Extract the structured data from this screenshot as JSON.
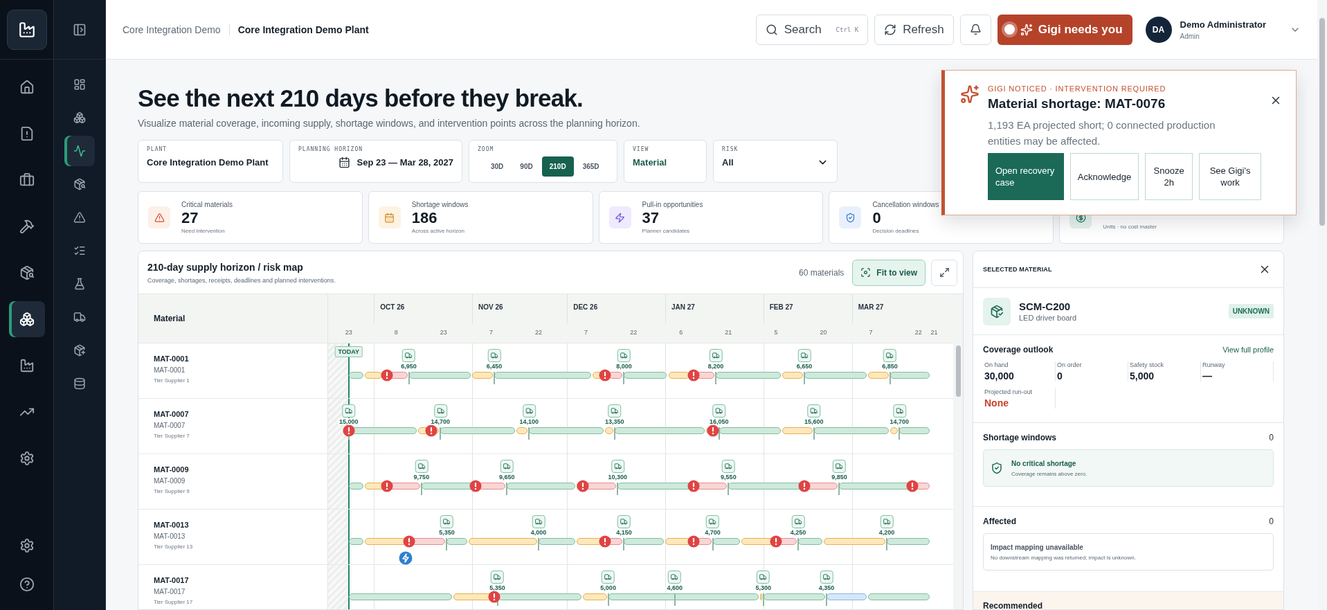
{
  "main_nav": [
    {
      "selected": false
    },
    {
      "selected": false
    },
    {
      "selected": false
    },
    {
      "selected": false
    },
    {
      "selected": false
    },
    {
      "selected": true
    },
    {
      "selected": false
    },
    {
      "selected": false
    },
    {
      "selected": false
    }
  ],
  "sub_nav": [
    {
      "selected": false
    },
    {
      "selected": false
    },
    {
      "selected": true
    },
    {
      "selected": false
    },
    {
      "selected": false
    },
    {
      "selected": false
    },
    {
      "selected": false
    },
    {
      "selected": false
    },
    {
      "selected": false
    },
    {
      "selected": false
    }
  ],
  "header": {
    "breadcrumbs": [
      "Core Integration Demo",
      "Core Integration Demo Plant"
    ],
    "search": {
      "label": "Search",
      "shortcut": "Ctrl K"
    },
    "refresh": "Refresh",
    "assistant": "Gigi needs you",
    "user": {
      "initials": "DA",
      "name": "Demo Administrator",
      "role": "Admin"
    }
  },
  "title": "See the next 210 days before they break.",
  "subtitle": "Visualize material coverage, incoming supply, shortage windows, and intervention points across the planning horizon.",
  "filters": {
    "plant": {
      "label": "PLANT",
      "value": "Core Integration Demo Plant"
    },
    "horizon": {
      "label": "PLANNING HORIZON",
      "value": "Sep 23 — Mar 28, 2027"
    },
    "zoom": {
      "label": "ZOOM",
      "options": [
        {
          "label": "30D",
          "selected": false
        },
        {
          "label": "90D",
          "selected": false
        },
        {
          "label": "210D",
          "selected": true
        },
        {
          "label": "365D",
          "selected": false
        }
      ]
    },
    "view": {
      "label": "VIEW",
      "value": "Material"
    },
    "risk": {
      "label": "RISK",
      "value": "All"
    }
  },
  "kpis": [
    {
      "kind": "critical",
      "label": "Critical materials",
      "value": "27",
      "note": "Need intervention"
    },
    {
      "kind": "shortage",
      "label": "Shortage windows",
      "value": "186",
      "note": "Across active horizon"
    },
    {
      "kind": "pullin",
      "label": "Pull-in opportunities",
      "value": "37",
      "note": "Planner candidates"
    },
    {
      "kind": "cancel",
      "label": "Cancellation windows",
      "value": "0",
      "note": "Decision deadlines"
    },
    {
      "kind": "value",
      "note": "Units · no cost master"
    }
  ],
  "chart": {
    "title": "210-day supply horizon / risk map",
    "subtitle": "Coverage, shortages, receipts, deadlines and planned interventions.",
    "count": "60 materials",
    "fit": "Fit to view",
    "column_header": "Material",
    "today": "TODAY",
    "months": [
      {
        "label": "OCT 26"
      },
      {
        "label": "NOV 26"
      },
      {
        "label": "DEC 26"
      },
      {
        "label": "JAN 27"
      },
      {
        "label": "FEB 27"
      },
      {
        "label": "MAR 27"
      }
    ],
    "ticks": [
      {
        "label": "23"
      },
      {
        "label": "8"
      },
      {
        "label": "23"
      },
      {
        "label": "7"
      },
      {
        "label": "22"
      },
      {
        "label": "7"
      },
      {
        "label": "22"
      },
      {
        "label": "6"
      },
      {
        "label": "21"
      },
      {
        "label": "5"
      },
      {
        "label": "20"
      },
      {
        "label": "7"
      },
      {
        "label": "22"
      },
      {
        "label": "21"
      }
    ],
    "rows": [
      {
        "name": "MAT-0001",
        "code": "MAT-0001",
        "supplier": "Tier Supplier 1",
        "segments": [
          {
            "kind": "ok"
          },
          {
            "kind": "warn"
          },
          {
            "kind": "short"
          },
          {
            "kind": "ok"
          },
          {
            "kind": "warn"
          },
          {
            "kind": "ok"
          },
          {
            "kind": "warn"
          },
          {
            "kind": "short"
          },
          {
            "kind": "ok"
          },
          {
            "kind": "warn"
          },
          {
            "kind": "short"
          },
          {
            "kind": "ok"
          },
          {
            "kind": "warn"
          },
          {
            "kind": "ok"
          },
          {
            "kind": "warn"
          },
          {
            "kind": "ok"
          }
        ],
        "receipts": [
          {
            "qty": "6,950"
          },
          {
            "qty": "6,450"
          },
          {
            "qty": "8,000"
          },
          {
            "qty": "8,200"
          },
          {
            "qty": "6,650"
          },
          {
            "qty": "6,850"
          }
        ],
        "markers": [
          {
            "kind": "alert"
          },
          {
            "kind": "alert"
          },
          {
            "kind": "alert"
          }
        ]
      },
      {
        "name": "MAT-0007",
        "code": "MAT-0007",
        "supplier": "Tier Supplier 7",
        "segments": [
          {
            "kind": "ok"
          },
          {
            "kind": "warn"
          },
          {
            "kind": "ok"
          },
          {
            "kind": "warn"
          },
          {
            "kind": "ok"
          },
          {
            "kind": "warn"
          },
          {
            "kind": "ok"
          },
          {
            "kind": "warn"
          },
          {
            "kind": "ok"
          },
          {
            "kind": "warn"
          },
          {
            "kind": "ok"
          },
          {
            "kind": "warn"
          },
          {
            "kind": "ok"
          }
        ],
        "receipts": [
          {
            "qty": "15,000"
          },
          {
            "qty": "14,700"
          },
          {
            "qty": "14,100"
          },
          {
            "qty": "13,350"
          },
          {
            "qty": "16,050"
          },
          {
            "qty": "15,600"
          },
          {
            "qty": "14,700"
          }
        ],
        "markers": [
          {
            "kind": "alert"
          },
          {
            "kind": "alert"
          },
          {
            "kind": "alert"
          }
        ]
      },
      {
        "name": "MAT-0009",
        "code": "MAT-0009",
        "supplier": "Tier Supplier 9",
        "segments": [
          {
            "kind": "ok"
          },
          {
            "kind": "warn"
          },
          {
            "kind": "short"
          },
          {
            "kind": "ok"
          },
          {
            "kind": "short"
          },
          {
            "kind": "ok"
          },
          {
            "kind": "warn"
          },
          {
            "kind": "short"
          },
          {
            "kind": "ok"
          },
          {
            "kind": "short"
          },
          {
            "kind": "ok"
          },
          {
            "kind": "short"
          },
          {
            "kind": "ok"
          },
          {
            "kind": "short"
          }
        ],
        "receipts": [
          {
            "qty": "9,750"
          },
          {
            "qty": "9,650"
          },
          {
            "qty": "10,300"
          },
          {
            "qty": "9,550"
          },
          {
            "qty": "9,850"
          }
        ],
        "markers": [
          {
            "kind": "alert"
          },
          {
            "kind": "alert"
          },
          {
            "kind": "alert"
          },
          {
            "kind": "alert"
          },
          {
            "kind": "alert"
          },
          {
            "kind": "alert"
          }
        ]
      },
      {
        "name": "MAT-0013",
        "code": "MAT-0013",
        "supplier": "Tier Supplier 13",
        "segments": [
          {
            "kind": "ok"
          },
          {
            "kind": "warn"
          },
          {
            "kind": "short"
          },
          {
            "kind": "ok"
          },
          {
            "kind": "warn"
          },
          {
            "kind": "ok"
          },
          {
            "kind": "warn"
          },
          {
            "kind": "short"
          },
          {
            "kind": "ok"
          },
          {
            "kind": "warn"
          },
          {
            "kind": "short"
          },
          {
            "kind": "ok"
          },
          {
            "kind": "warn"
          },
          {
            "kind": "short"
          },
          {
            "kind": "ok"
          },
          {
            "kind": "warn"
          },
          {
            "kind": "ok"
          }
        ],
        "receipts": [
          {
            "qty": "5,350"
          },
          {
            "qty": "4,000"
          },
          {
            "qty": "4,150"
          },
          {
            "qty": "4,700"
          },
          {
            "qty": "4,250"
          },
          {
            "qty": "4,200"
          }
        ],
        "markers": [
          {
            "kind": "alert"
          },
          {
            "kind": "bolt"
          },
          {
            "kind": "alert"
          },
          {
            "kind": "alert"
          },
          {
            "kind": "alert"
          }
        ]
      },
      {
        "name": "MAT-0017",
        "code": "MAT-0017",
        "supplier": "Tier Supplier 17",
        "segments": [
          {
            "kind": "ok"
          },
          {
            "kind": "warn"
          },
          {
            "kind": "ok"
          },
          {
            "kind": "warn"
          },
          {
            "kind": "ok"
          },
          {
            "kind": "warn"
          },
          {
            "kind": "ok"
          },
          {
            "kind": "planned"
          },
          {
            "kind": "ok"
          }
        ],
        "receipts": [
          {
            "qty": "5,350"
          },
          {
            "qty": "5,000"
          },
          {
            "qty": "4,600"
          },
          {
            "qty": "5,300"
          },
          {
            "qty": "4,350"
          }
        ],
        "markers": [
          {
            "kind": "alert"
          }
        ]
      }
    ]
  },
  "selected": {
    "heading": "SELECTED MATERIAL",
    "code": "SCM-C200",
    "name": "LED driver board",
    "status": "UNKNOWN",
    "coverage": {
      "title": "Coverage outlook",
      "link": "View full profile",
      "stats": [
        {
          "label": "On hand",
          "value": "30,000",
          "kind": "plain"
        },
        {
          "label": "On order",
          "value": "0",
          "kind": "plain"
        },
        {
          "label": "Safety stock",
          "value": "5,000",
          "kind": "plain"
        },
        {
          "label": "Runway",
          "value": "—",
          "kind": "plain"
        },
        {
          "label": "Projected run-out",
          "value": "None",
          "kind": "alert"
        }
      ]
    },
    "shortage": {
      "title": "Shortage windows",
      "count": "0",
      "message": "No critical shortage",
      "detail": "Coverage remains above zero."
    },
    "affected": {
      "title": "Affected",
      "count": "0",
      "message": "Impact mapping unavailable",
      "detail": "No downstream mapping was returned; impact is unknown."
    },
    "recommended": "Recommended"
  },
  "notice": {
    "eyebrow": "GIGI NOTICED · INTERVENTION REQUIRED",
    "title": "Material shortage: MAT-0076",
    "body": "1,193 EA projected short; 0 connected production entities may be affected.",
    "actions": [
      {
        "label": "Open recovery case",
        "primary": true
      },
      {
        "label": "Acknowledge",
        "primary": false
      },
      {
        "label": "Snooze 2h",
        "primary": false
      },
      {
        "label": "See Gigi's work",
        "primary": false
      }
    ]
  }
}
